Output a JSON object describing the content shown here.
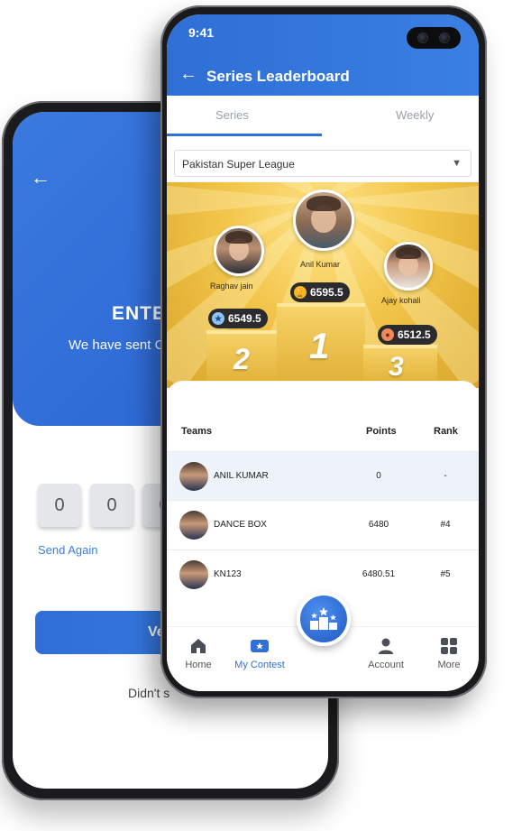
{
  "back_phone": {
    "back_arrow": "←",
    "title": "ENTE",
    "subtitle": "We have sent C",
    "otp_digits": [
      "0",
      "0",
      "0"
    ],
    "send_again": "Send Again",
    "verify_label": "Ve",
    "didnt_label": "Didn't s"
  },
  "status_bar": {
    "time": "9:41"
  },
  "header": {
    "back_arrow": "←",
    "title": "Series Leaderboard"
  },
  "tabs": [
    {
      "label": "Series",
      "active": true
    },
    {
      "label": "Weekly",
      "active": false
    }
  ],
  "league_select": {
    "value": "Pakistan Super League",
    "caret": "▼"
  },
  "podium": {
    "first": {
      "name": "Anil Kumar",
      "score": "6595.5",
      "rank": "1"
    },
    "second": {
      "name": "Raghav jain",
      "score": "6549.5",
      "rank": "2"
    },
    "third": {
      "name": "Ajay kohali",
      "score": "6512.5",
      "rank": "3"
    }
  },
  "table": {
    "headers": {
      "teams": "Teams",
      "points": "Points",
      "rank": "Rank"
    },
    "rows": [
      {
        "team": "ANIL KUMAR",
        "points": "0",
        "rank": "-"
      },
      {
        "team": "DANCE BOX",
        "points": "6480",
        "rank": "#4"
      },
      {
        "team": "KN123",
        "points": "6480.51",
        "rank": "#5"
      }
    ]
  },
  "bottom_nav": {
    "home": "Home",
    "my_contest": "My Contest",
    "account": "Account",
    "more": "More"
  },
  "colors": {
    "primary": "#2f6fd6",
    "podium_gold": "#f2c54a",
    "highlight_row": "#eef3fa"
  },
  "icons": {
    "back": "arrow-left-icon",
    "home": "home-icon",
    "contest": "ticket-icon",
    "account": "user-icon",
    "more": "grid-icon",
    "fab": "leaderboard-stars-icon"
  }
}
